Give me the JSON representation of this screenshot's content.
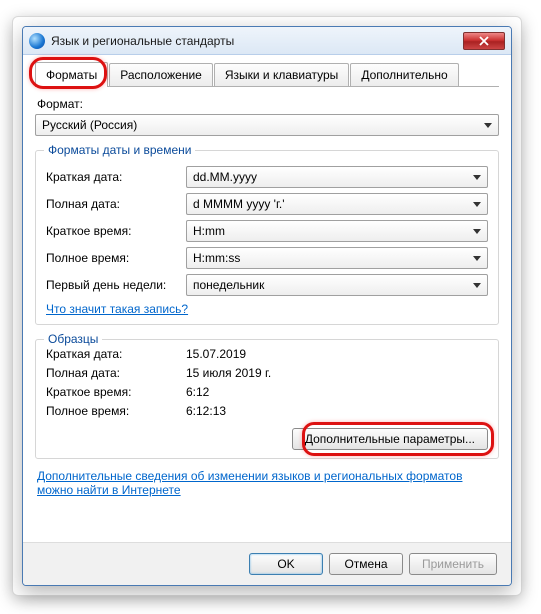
{
  "window": {
    "title": "Язык и региональные стандарты"
  },
  "tabs": {
    "t0": "Форматы",
    "t1": "Расположение",
    "t2": "Языки и клавиатуры",
    "t3": "Дополнительно"
  },
  "format": {
    "label": "Формат:",
    "value": "Русский (Россия)"
  },
  "dtGroup": {
    "legend": "Форматы даты и времени",
    "shortDateLabel": "Краткая дата:",
    "shortDateValue": "dd.MM.yyyy",
    "longDateLabel": "Полная дата:",
    "longDateValue": "d MMMM yyyy 'г.'",
    "shortTimeLabel": "Краткое время:",
    "shortTimeValue": "H:mm",
    "longTimeLabel": "Полное время:",
    "longTimeValue": "H:mm:ss",
    "firstDayLabel": "Первый день недели:",
    "firstDayValue": "понедельник",
    "whatLink": "Что значит такая запись?"
  },
  "samples": {
    "legend": "Образцы",
    "shortDateLabel": "Краткая дата:",
    "shortDateValue": "15.07.2019",
    "longDateLabel": "Полная дата:",
    "longDateValue": "15 июля 2019 г.",
    "shortTimeLabel": "Краткое время:",
    "shortTimeValue": "6:12",
    "longTimeLabel": "Полное время:",
    "longTimeValue": "6:12:13"
  },
  "advancedButton": "Дополнительные параметры...",
  "helpLink": "Дополнительные сведения об изменении языков и региональных форматов можно найти в Интернете",
  "buttons": {
    "ok": "OK",
    "cancel": "Отмена",
    "apply": "Применить"
  }
}
